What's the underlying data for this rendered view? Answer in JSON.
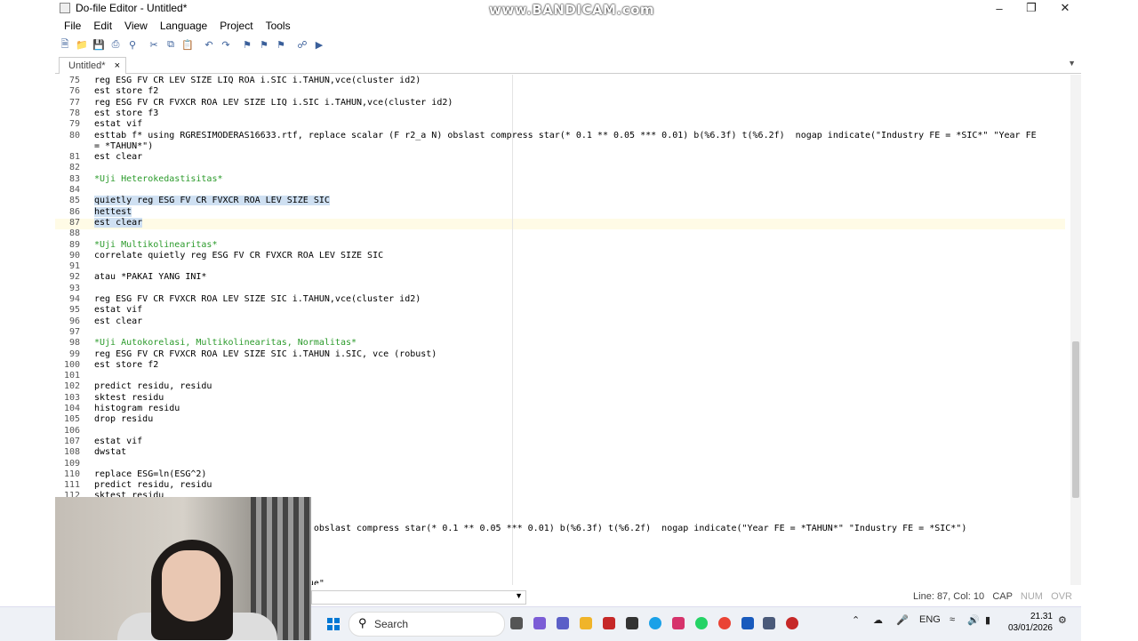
{
  "window": {
    "title": "Do-file Editor - Untitled*",
    "watermark": "www.BANDICAM.com"
  },
  "menu": [
    "File",
    "Edit",
    "View",
    "Language",
    "Project",
    "Tools"
  ],
  "toolbar_icons": [
    "new-file-icon",
    "open-folder-icon",
    "save-icon",
    "print-icon",
    "find-icon",
    "cut-icon",
    "copy-icon",
    "paste-icon",
    "undo-icon",
    "redo-icon",
    "bookmark-toggle-icon",
    "bookmark-prev-icon",
    "bookmark-next-icon",
    "show-file-icon",
    "execute-icon"
  ],
  "tab": {
    "label": "Untitled*",
    "close": "×"
  },
  "editor": {
    "lines": [
      {
        "n": "75",
        "text": "reg ESG FV CR LEV SIZE LIQ ROA i.SIC i.TAHUN,vce(cluster id2)"
      },
      {
        "n": "76",
        "text": "est store f2"
      },
      {
        "n": "77",
        "text": "reg ESG FV CR FVXCR ROA LEV SIZE LIQ i.SIC i.TAHUN,vce(cluster id2)"
      },
      {
        "n": "78",
        "text": "est store f3"
      },
      {
        "n": "79",
        "text": "estat vif"
      },
      {
        "n": "80",
        "text": "esttab f* using RGRESIMODERAS16633.rtf, replace scalar (F r2_a N) obslast compress star(* 0.1 ** 0.05 *** 0.01) b(%6.3f) t(%6.2f)  nogap indicate(\"Industry FE = *SIC*\" \"Year FE"
      },
      {
        "n": "",
        "text": "= *TAHUN*\")"
      },
      {
        "n": "81",
        "text": "est clear"
      },
      {
        "n": "82",
        "text": ""
      },
      {
        "n": "83",
        "text": "*Uji Heterokedastisitas*",
        "comment": true
      },
      {
        "n": "84",
        "text": ""
      },
      {
        "n": "85",
        "text": "quietly reg ESG FV CR FVXCR ROA LEV SIZE SIC",
        "sel": true
      },
      {
        "n": "86",
        "text": "hettest",
        "sel": true
      },
      {
        "n": "87",
        "text": "est clear",
        "sel": true
      },
      {
        "n": "88",
        "text": ""
      },
      {
        "n": "89",
        "text": "*Uji Multikolinearitas*",
        "comment": true
      },
      {
        "n": "90",
        "text": "correlate quietly reg ESG FV CR FVXCR ROA LEV SIZE SIC"
      },
      {
        "n": "91",
        "text": ""
      },
      {
        "n": "92",
        "text": "atau *PAKAI YANG INI*"
      },
      {
        "n": "93",
        "text": ""
      },
      {
        "n": "94",
        "text": "reg ESG FV CR FVXCR ROA LEV SIZE SIC i.TAHUN,vce(cluster id2)"
      },
      {
        "n": "95",
        "text": "estat vif"
      },
      {
        "n": "96",
        "text": "est clear"
      },
      {
        "n": "97",
        "text": ""
      },
      {
        "n": "98",
        "text": "*Uji Autokorelasi, Multikolinearitas, Normalitas*",
        "comment": true
      },
      {
        "n": "99",
        "text": "reg ESG FV CR FVXCR ROA LEV SIZE SIC i.TAHUN i.SIC, vce (robust)"
      },
      {
        "n": "100",
        "text": "est store f2"
      },
      {
        "n": "101",
        "text": ""
      },
      {
        "n": "102",
        "text": "predict residu, residu"
      },
      {
        "n": "103",
        "text": "sktest residu"
      },
      {
        "n": "104",
        "text": "histogram residu"
      },
      {
        "n": "105",
        "text": "drop residu"
      },
      {
        "n": "106",
        "text": ""
      },
      {
        "n": "107",
        "text": "estat vif"
      },
      {
        "n": "108",
        "text": "dwstat"
      },
      {
        "n": "109",
        "text": ""
      },
      {
        "n": "110",
        "text": "replace ESG=ln(ESG^2)"
      },
      {
        "n": "111",
        "text": "predict residu, residu"
      },
      {
        "n": "112",
        "text": "sktest residu"
      },
      {
        "n": "",
        "text": ""
      },
      {
        "n": "",
        "text": ""
      },
      {
        "n": "",
        "text": "                           ar (F r2_a N) obslast compress star(* 0.1 ** 0.05 *** 0.01) b(%6.3f) t(%6.2f)  nogap indicate(\"Year FE = *TAHUN*\" \"Industry FE = *SIC*\")"
      },
      {
        "n": "",
        "text": ""
      },
      {
        "n": "",
        "text": ""
      },
      {
        "n": "",
        "text": ""
      },
      {
        "n": "",
        "text": ""
      },
      {
        "n": "",
        "text": "                           High Firm Value\""
      }
    ]
  },
  "status": {
    "position": "Line: 87, Col: 10",
    "cap": "CAP",
    "num": "NUM",
    "ovr": "OVR"
  },
  "taskbar": {
    "search": "Search",
    "lang": "ENG",
    "time": "21.31",
    "date": "03/01/2026"
  }
}
